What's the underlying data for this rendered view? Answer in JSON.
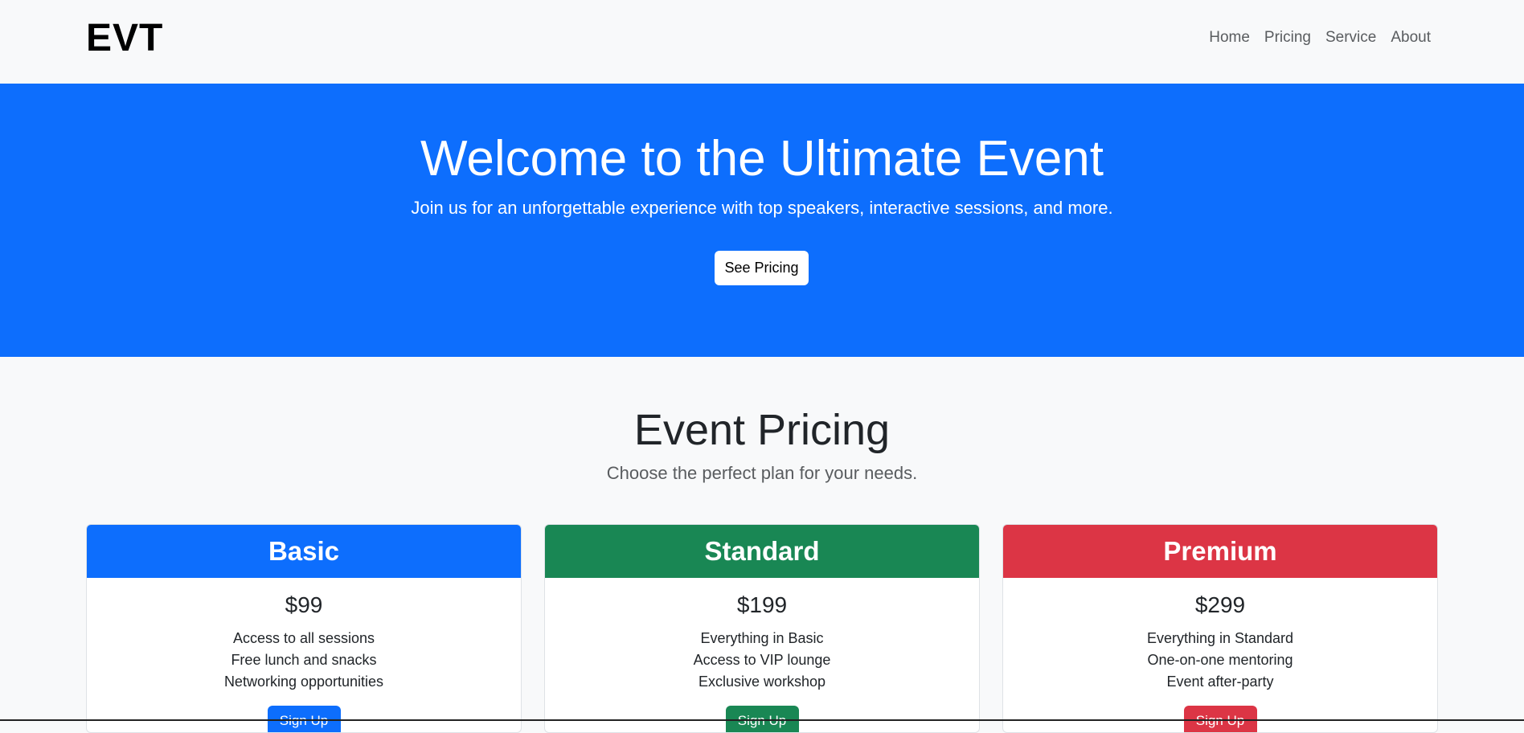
{
  "navbar": {
    "brand": "EVT",
    "links": [
      "Home",
      "Pricing",
      "Service",
      "About"
    ]
  },
  "hero": {
    "title": "Welcome to the Ultimate Event",
    "subtitle": "Join us for an unforgettable experience with top speakers, interactive sessions, and more.",
    "button_label": "See Pricing",
    "background_color": "#0d6efd"
  },
  "pricing": {
    "title": "Event Pricing",
    "subtitle": "Choose the perfect plan for your needs.",
    "plans": [
      {
        "name": "Basic",
        "price": "$99",
        "features": [
          "Access to all sessions",
          "Free lunch and snacks",
          "Networking opportunities"
        ],
        "button_label": "Sign Up",
        "color": "#0d6efd"
      },
      {
        "name": "Standard",
        "price": "$199",
        "features": [
          "Everything in Basic",
          "Access to VIP lounge",
          "Exclusive workshop"
        ],
        "button_label": "Sign Up",
        "color": "#198754"
      },
      {
        "name": "Premium",
        "price": "$299",
        "features": [
          "Everything in Standard",
          "One-on-one mentoring",
          "Event after-party"
        ],
        "button_label": "Sign Up",
        "color": "#dc3545"
      }
    ]
  }
}
